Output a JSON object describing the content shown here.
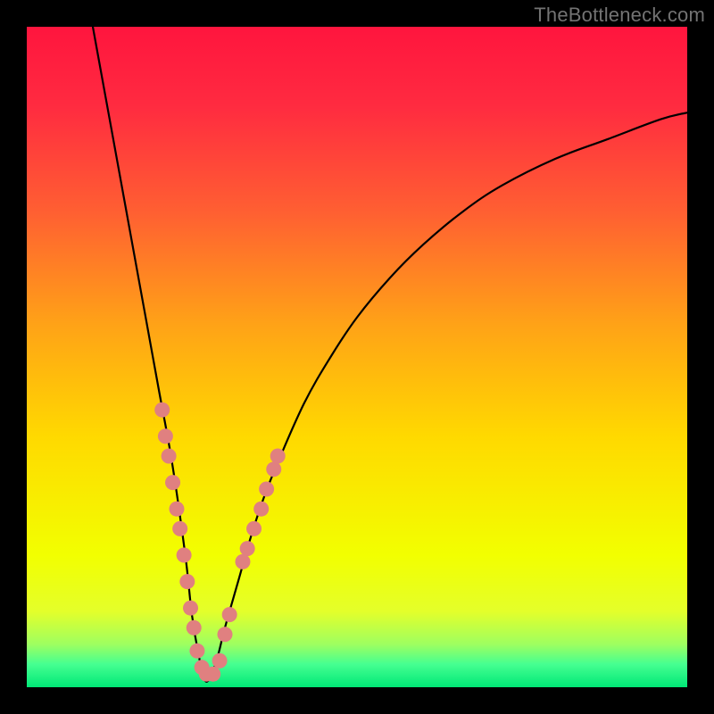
{
  "watermark": "TheBottleneck.com",
  "gradient": {
    "stops": [
      {
        "offset": 0.0,
        "color": "#ff153e"
      },
      {
        "offset": 0.12,
        "color": "#ff2b40"
      },
      {
        "offset": 0.28,
        "color": "#ff5f32"
      },
      {
        "offset": 0.45,
        "color": "#ffa217"
      },
      {
        "offset": 0.62,
        "color": "#ffd900"
      },
      {
        "offset": 0.8,
        "color": "#f2ff00"
      },
      {
        "offset": 0.885,
        "color": "#e4ff2a"
      },
      {
        "offset": 0.935,
        "color": "#9eff60"
      },
      {
        "offset": 0.965,
        "color": "#46ff91"
      },
      {
        "offset": 1.0,
        "color": "#00e877"
      }
    ]
  },
  "chart_data": {
    "type": "line",
    "title": "",
    "xlabel": "",
    "ylabel": "",
    "xlim": [
      0,
      100
    ],
    "ylim": [
      0,
      100
    ],
    "minimum_x": 27,
    "series": [
      {
        "name": "bottleneck-curve",
        "x": [
          10,
          12,
          14,
          16,
          18,
          20,
          22,
          24,
          25,
          26,
          27,
          28,
          29,
          30,
          32,
          34,
          36,
          38,
          42,
          46,
          50,
          55,
          60,
          66,
          72,
          80,
          88,
          96,
          100
        ],
        "y": [
          100,
          89,
          78,
          67,
          56,
          45,
          34,
          20,
          11,
          5,
          1,
          2,
          5,
          9,
          16,
          23,
          29,
          34,
          43,
          50,
          56,
          62,
          67,
          72,
          76,
          80,
          83,
          86,
          87
        ]
      }
    ],
    "annotations": {
      "name": "datapoint-markers",
      "color": "#e08080",
      "points": [
        {
          "x": 20.5,
          "y": 42
        },
        {
          "x": 21.0,
          "y": 38
        },
        {
          "x": 21.5,
          "y": 35
        },
        {
          "x": 22.1,
          "y": 31
        },
        {
          "x": 22.7,
          "y": 27
        },
        {
          "x": 23.2,
          "y": 24
        },
        {
          "x": 23.8,
          "y": 20
        },
        {
          "x": 24.3,
          "y": 16
        },
        {
          "x": 24.8,
          "y": 12
        },
        {
          "x": 25.3,
          "y": 9
        },
        {
          "x": 25.8,
          "y": 5.5
        },
        {
          "x": 26.5,
          "y": 3
        },
        {
          "x": 27.2,
          "y": 2
        },
        {
          "x": 28.2,
          "y": 2
        },
        {
          "x": 29.2,
          "y": 4
        },
        {
          "x": 30.0,
          "y": 8
        },
        {
          "x": 30.7,
          "y": 11
        },
        {
          "x": 32.7,
          "y": 19
        },
        {
          "x": 33.4,
          "y": 21
        },
        {
          "x": 34.4,
          "y": 24
        },
        {
          "x": 35.5,
          "y": 27
        },
        {
          "x": 36.3,
          "y": 30
        },
        {
          "x": 37.4,
          "y": 33
        },
        {
          "x": 38.0,
          "y": 35
        }
      ]
    }
  }
}
